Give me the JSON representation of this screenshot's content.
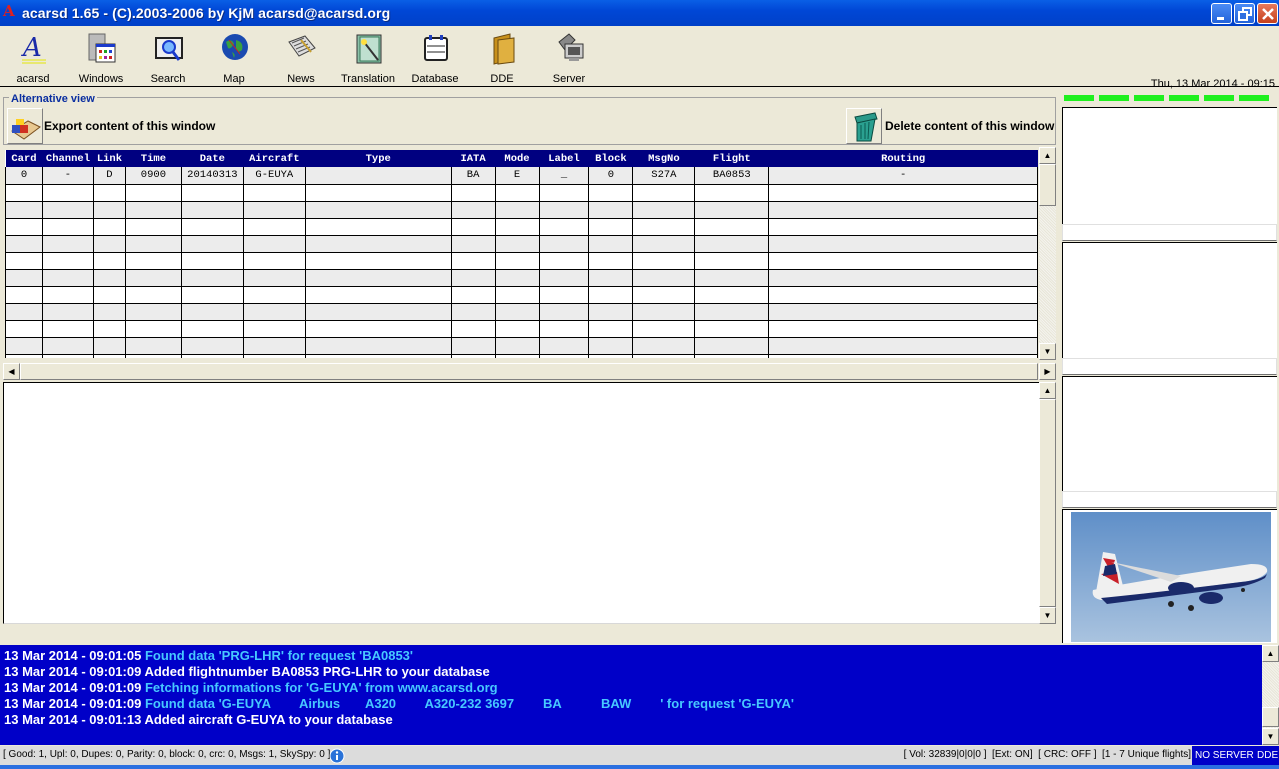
{
  "window": {
    "title": "acarsd 1.65 - (C).2003-2006 by KjM acarsd@acarsd.org",
    "controls": [
      "minimize",
      "restore",
      "close"
    ]
  },
  "toolbar": {
    "items": [
      {
        "label": "acarsd",
        "icon": "acarsd-logo-icon"
      },
      {
        "label": "Windows",
        "icon": "windows-icon"
      },
      {
        "label": "Search",
        "icon": "search-icon"
      },
      {
        "label": "Map",
        "icon": "globe-icon"
      },
      {
        "label": "News",
        "icon": "newspaper-icon"
      },
      {
        "label": "Translation",
        "icon": "book-wand-icon"
      },
      {
        "label": "Database",
        "icon": "card-file-icon"
      },
      {
        "label": "DDE",
        "icon": "folder-icon"
      },
      {
        "label": "Server",
        "icon": "server-icon"
      }
    ],
    "clock": "Thu, 13 Mar 2014 - 09:15"
  },
  "alt_view": {
    "legend": "Alternative view",
    "export_label": "Export content of this window",
    "delete_label": "Delete content of this window"
  },
  "grid": {
    "columns": [
      "Card",
      "Channel",
      "Link",
      "Time",
      "Date",
      "Aircraft",
      "Type",
      "IATA",
      "Mode",
      "Label",
      "Block",
      "MsgNo",
      "Flight",
      "Routing"
    ],
    "rows": [
      [
        "0",
        "-",
        "D",
        "0900",
        "20140313",
        "G-EUYA",
        "",
        "BA",
        "E",
        "_",
        "0",
        "S27A",
        "BA0853",
        "-"
      ]
    ],
    "empty_rows": 11
  },
  "right_panel": {
    "leds": 6,
    "led_color": "#1ef01e",
    "image_alt": "British Airways Airbus A320 in flight"
  },
  "log": {
    "lines": [
      {
        "ts": "13 Mar 2014 - 09:01:05",
        "msg": "Found data 'PRG-LHR' for request 'BA0853'",
        "color": "cyan"
      },
      {
        "ts": "13 Mar 2014 - 09:01:09",
        "msg": "Added flightnumber BA0853 PRG-LHR to your database",
        "color": "white"
      },
      {
        "ts": "13 Mar 2014 - 09:01:09",
        "msg": "Fetching informations for 'G-EUYA' from www.acarsd.org",
        "color": "cyan"
      },
      {
        "ts": "13 Mar 2014 - 09:01:09",
        "msg": "Found data 'G-EUYA        Airbus       A320        A320-232 3697        BA           BAW        ' for request 'G-EUYA'",
        "color": "cyan"
      },
      {
        "ts": "13 Mar 2014 - 09:01:13",
        "msg": "Added aircraft G-EUYA to your database",
        "color": "white"
      }
    ]
  },
  "status": {
    "left": "[ Good: 1, Upl: 0, Dupes: 0, Parity: 0, block: 0, crc: 0, Msgs: 1, SkySpy: 0 ]",
    "right": "[ Vol: 32839|0|0|0 ]  [Ext: ON]  [ CRC: OFF ]  [1 - 7 Unique flights]",
    "server": "NO SERVER",
    "dde": "DDE"
  }
}
